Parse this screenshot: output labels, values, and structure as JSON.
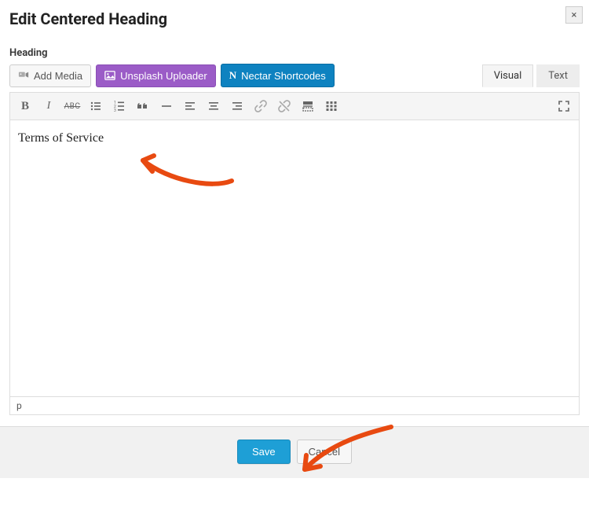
{
  "close_label": "×",
  "modal_title": "Edit Centered Heading",
  "field_label": "Heading",
  "buttons": {
    "add_media": "Add Media",
    "unsplash": "Unsplash Uploader",
    "nectar": "Nectar Shortcodes"
  },
  "tabs": {
    "visual": "Visual",
    "text": "Text"
  },
  "toolbar": {
    "bold": "B",
    "italic": "I",
    "strike": "ABC"
  },
  "editor": {
    "content": "Terms of Service",
    "path": "p"
  },
  "footer": {
    "save": "Save",
    "cancel": "Cancel"
  },
  "colors": {
    "purple": "#9b5cc7",
    "blue_btn": "#0e82c0",
    "save_blue": "#1e9fd6",
    "annotation": "#e84a11"
  }
}
